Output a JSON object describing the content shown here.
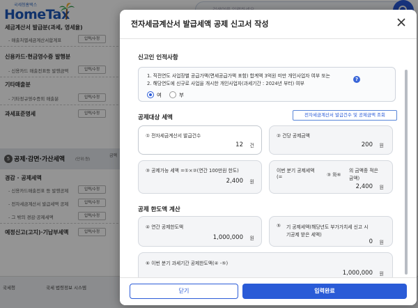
{
  "background": {
    "logo_sub": "국세청홈택스",
    "logo_main": "HomeTax",
    "search_placeholder": "검색어를 입력하세요",
    "sections": [
      {
        "title": "세금계산서 발급분(과세, 영세율)",
        "items": [
          {
            "label": "- 매출처별세금계산서합계표",
            "button": "입력/수정"
          }
        ]
      },
      {
        "title": "신용카드·현금영수증 발행분",
        "items": [
          {
            "label": "- 신용카드 매출전표등 발행금액",
            "button": "입력/수정"
          }
        ]
      },
      {
        "title": "기타매출분",
        "items": [
          {
            "label": "- 기타정규영수증외 매출분",
            "button": "입력/수정"
          }
        ]
      },
      {
        "title": "과세표준명세",
        "items": [
          {
            "label": "",
            "button": "입력/수정"
          }
        ]
      }
    ],
    "band_num": "5",
    "band_title": "공제·감면·가산세액",
    "band_sub": "(단위:원)",
    "mid_label": "금액",
    "section2": [
      {
        "title": "경감 · 공제세액",
        "items": [
          {
            "label": "- 신용카드매출전표 등 발행공제",
            "button": "입력/수정"
          },
          {
            "label": "- 전자세금계산서 발급세액 공제",
            "button": "입력/수정"
          },
          {
            "label": "- 그 밖의 경감·공제세액",
            "button": "입력/수정"
          }
        ]
      },
      {
        "title": "예정신고(고지)·기납부세액",
        "items": [
          {
            "label": "",
            "button": "입력/수정"
          }
        ]
      }
    ],
    "bottom_links": [
      "국세청",
      "국세 법령정보 시스템"
    ]
  },
  "modal": {
    "title": "전자세금계산서 발급세액 공제 신고서 작성",
    "section_reporter": "신고인 인적사항",
    "notice_lines": [
      "1. 직전연도 사업장별 공급가액(면세공급가액 포함) 합계액 3억원 미만 개인사업자 여부 또는",
      "2. 해당연도에 신규로 사업을 개시한 개인사업자(과세기간 : 2024년 부터) 여부"
    ],
    "help_glyph": "?",
    "radio_yes": "여",
    "radio_no": "부",
    "selected": "yes",
    "section_target": "공제대상 세액",
    "lookup_button": "전자세금계산서 발급건수 및 공제금액 조회",
    "field1_label": "① 전자세금계산서 발급건수",
    "field1_value": "12",
    "field1_unit": "건",
    "field2_label": "② 건당 공제금액",
    "field2_value": "200",
    "field2_unit": "원",
    "field3_label": "③ 공제가능 세액 =①×②(연간 100만원 한도)",
    "field3_value": "2,400",
    "field3_unit": "원",
    "field4_label_a": "이번 분기 공제세액",
    "field4_label_b": "(=",
    "field4_label_c": "③ 와⑥",
    "field4_label_d": "의 금액중 적은",
    "field4_label_e": "금액)",
    "field4_value": "2,400",
    "field4_unit": "원",
    "section_limit": "공제 한도액 계산",
    "field5_label": "④ 연간 공제한도액",
    "field5_value": "1,000,000",
    "field5_unit": "원",
    "field6_label_a": "⑤",
    "field6_label_b": "기 공제세액(해당년도 부가가치세 신고 시",
    "field6_label_c": "기공제 받은 세액)",
    "field6_value": "0",
    "field6_unit": "원",
    "field7_label": "⑥ 이번 분기 과세기간 공제한도액(④ -⑤)",
    "field7_value": "1,000,000",
    "field7_unit": "원",
    "close_button": "닫기",
    "submit_button": "입력완료"
  }
}
